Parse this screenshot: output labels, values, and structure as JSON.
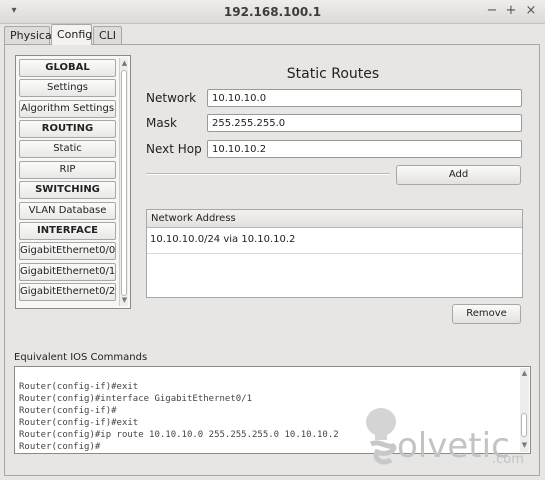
{
  "window": {
    "title": "192.168.100.1",
    "menu_icon": "chevron-down-icon",
    "controls": [
      "−",
      "+",
      "×"
    ]
  },
  "tabs": [
    {
      "label": "Physical"
    },
    {
      "label": "Config"
    },
    {
      "label": "CLI"
    }
  ],
  "active_tab": "Config",
  "nav": {
    "items": [
      {
        "label": "GLOBAL",
        "header": true
      },
      {
        "label": "Settings",
        "header": false
      },
      {
        "label": "Algorithm Settings",
        "header": false
      },
      {
        "label": "ROUTING",
        "header": true
      },
      {
        "label": "Static",
        "header": false
      },
      {
        "label": "RIP",
        "header": false
      },
      {
        "label": "SWITCHING",
        "header": true
      },
      {
        "label": "VLAN Database",
        "header": false
      },
      {
        "label": "INTERFACE",
        "header": true
      },
      {
        "label": "GigabitEthernet0/0",
        "header": false
      },
      {
        "label": "GigabitEthernet0/1",
        "header": false
      },
      {
        "label": "GigabitEthernet0/2",
        "header": false
      }
    ]
  },
  "static_routes": {
    "title": "Static Routes",
    "network_label": "Network",
    "network_value": "10.10.10.0",
    "mask_label": "Mask",
    "mask_value": "255.255.255.0",
    "nexthop_label": "Next Hop",
    "nexthop_value": "10.10.10.2",
    "add_label": "Add",
    "table_header": "Network Address",
    "routes": [
      "10.10.10.0/24 via 10.10.10.2"
    ],
    "remove_label": "Remove"
  },
  "ios": {
    "label": "Equivalent IOS Commands",
    "lines": [
      "Router(config-if)#exit",
      "Router(config)#interface GigabitEthernet0/1",
      "Router(config-if)#",
      "Router(config-if)#exit",
      "Router(config)#ip route 10.10.10.0 255.255.255.0 10.10.10.2",
      "Router(config)#"
    ]
  },
  "watermark": {
    "text": "olvetic",
    "suffix": ".com"
  },
  "colors": {
    "background": "#e7e6e4",
    "watermark": "#c3c3c3"
  }
}
